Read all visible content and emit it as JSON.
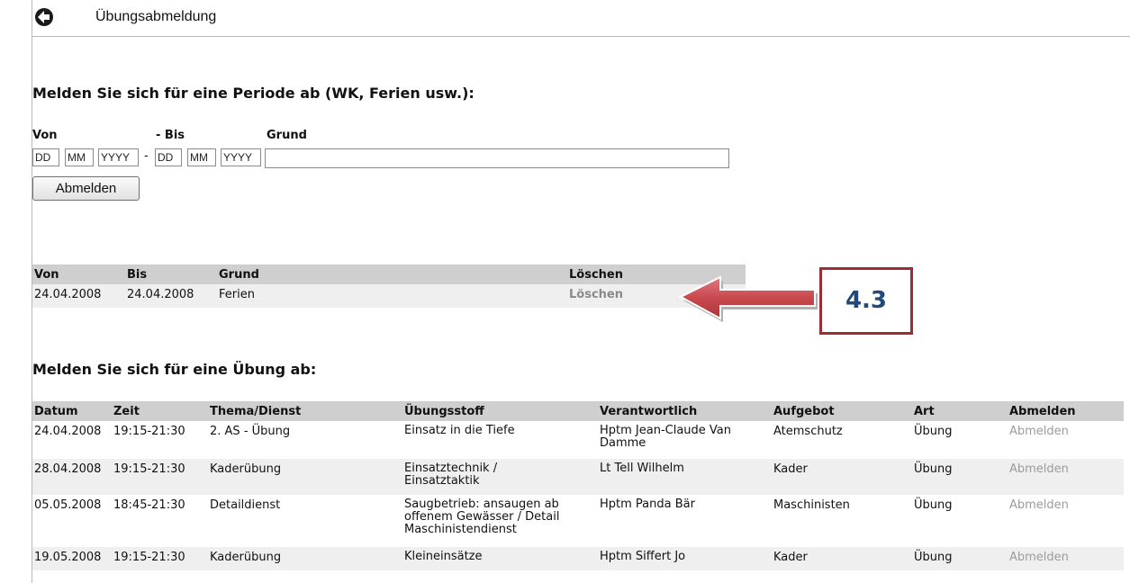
{
  "header": {
    "title": "Übungsabmeldung"
  },
  "period_form": {
    "heading": "Melden Sie sich für eine Periode ab (WK, Ferien usw.):",
    "label_von": "Von",
    "label_bis": "- Bis",
    "label_grund": "Grund",
    "from_day": "DD",
    "from_month": "MM",
    "from_year": "YYYY",
    "separator": "-",
    "to_day": "DD",
    "to_month": "MM",
    "to_year": "YYYY",
    "grund_value": "",
    "submit_label": "Abmelden"
  },
  "period_table": {
    "headers": [
      "Von",
      "Bis",
      "Grund",
      "Löschen"
    ],
    "rows": [
      {
        "von": "24.04.2008",
        "bis": "24.04.2008",
        "grund": "Ferien",
        "action": "Löschen"
      }
    ]
  },
  "annotation": {
    "label": "4.3",
    "colors": {
      "border": "#9a2e33",
      "text": "#1f4a7a",
      "arrow": "#c9494f"
    }
  },
  "exercise_section": {
    "heading": "Melden Sie sich für eine Übung ab:",
    "headers": [
      "Datum",
      "Zeit",
      "Thema/Dienst",
      "Übungsstoff",
      "Verantwortlich",
      "Aufgebot",
      "Art",
      "Abmelden"
    ],
    "rows": [
      {
        "datum": "24.04.2008",
        "zeit": "19:15-21:30",
        "thema": "2. AS - Übung",
        "stoff": "Einsatz in die Tiefe",
        "verantwortlich": "Hptm Jean-Claude Van Damme",
        "aufgebot": "Atemschutz",
        "art": "Übung",
        "action": "Abmelden"
      },
      {
        "datum": "28.04.2008",
        "zeit": "19:15-21:30",
        "thema": "Kaderübung",
        "stoff": "Einsatztechnik / Einsatztaktik",
        "verantwortlich": "Lt Tell Wilhelm",
        "aufgebot": "Kader",
        "art": "Übung",
        "action": "Abmelden"
      },
      {
        "datum": "05.05.2008",
        "zeit": "18:45-21:30",
        "thema": "Detaildienst",
        "stoff": "Saugbetrieb: ansaugen ab offenem Gewässer / Detail Maschinistendienst",
        "verantwortlich": "Hptm Panda Bär",
        "aufgebot": "Maschinisten",
        "art": "Übung",
        "action": "Abmelden"
      },
      {
        "datum": "19.05.2008",
        "zeit": "19:15-21:30",
        "thema": "Kaderübung",
        "stoff": "Kleineinsätze",
        "verantwortlich": "Hptm Siffert Jo",
        "aufgebot": "Kader",
        "art": "Übung",
        "action": "Abmelden"
      }
    ]
  }
}
